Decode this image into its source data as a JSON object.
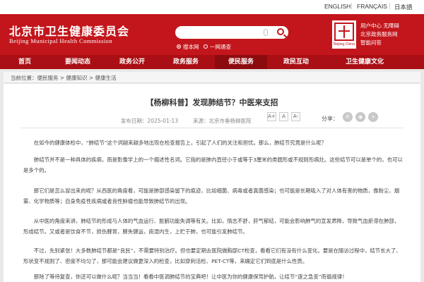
{
  "topbar": {
    "languages": [
      "ENGLISH",
      "FRANÇAIS",
      "日本語"
    ]
  },
  "header": {
    "site_name": "北京市卫生健康委员会",
    "site_name_en": "Beijing Municipal Health Commission",
    "search": {
      "placeholder": "",
      "scope_site": "搜本网",
      "scope_all": "一网通查"
    },
    "logo_text": "Beijing·China",
    "right_links": [
      "用户中心 无障碍",
      "北京政务服务网",
      "智能问答"
    ]
  },
  "nav": {
    "items": [
      "首页",
      "要闻动态",
      "政务公开",
      "政务服务",
      "便民服务",
      "政民互动",
      "卫生健康文化"
    ],
    "active_index": 4
  },
  "breadcrumb": "当前位置：便民服务 > 健康知识 > 健康生活",
  "article": {
    "title": "【杨柳科普】发现肺结节？中医来支招",
    "publish_time": "发布日期：2025-01-13",
    "source": "来源：北京市垂杨柳医院",
    "font_sizes": [
      "A+",
      "A",
      "A-"
    ],
    "share_label": "分享：",
    "share_icons": [
      "wechat-icon",
      "weibo-icon",
      "more-share-icon"
    ],
    "paragraphs": [
      "在如今的健康体检中，“肺结节”这个词越来越多地出现在检查报告上，引起了人们的关注和担忧。那么，肺结节究竟是什么呢？",
      "肺结节并不是一种具体的疾病，而是影像学上的一个描述性名词。它指的是肺内直径小于或等于3厘米的类圆形或不规则形病灶。这些结节可以是单个的，也可以是多个的。",
      "那它们是怎么冒出来的呢？从西医的角度看，可能是肺部感染留下的痕迹，比如细菌、病毒或者真菌感染；也可能是长期吸入了对人体有害的物质，像粉尘、烟雾、化学物质等；自身免疫性疾病或者良性肿瘤也能导致肺结节的出现。",
      "从中医的角度来讲，肺结节的形成与人体的气血运行、脏腑功能失调等有关。比如，情志不舒，肝气郁结，可能会影响肺气的宣发肃降，导致气血瘀滞在肺部，形成结节。又或者是饮食不节，损伤脾胃，脾失健运，痰湿内生，上贮于肺，也可能引发肺结节。",
      "不过，先别紧张！大多数肺结节都是“良民”，不需要特别治疗。但也要定期去医院做胸部CT检查，看看它们有没有什么变化。要是在随访过程中，结节长大了、形状变不规则了、密度不均匀了，那可能会建议做更深入的检查，比如穿刺活检、PET-CT等，来确定它们到底是什么性质。",
      "那除了等待复查，你还可以做什么呢？当当当！看看中医调肺结节的宝典吧！让中医为你的健康保驾护航，让结节“逐之急变”而循规律！"
    ]
  },
  "colors": {
    "brand_red": "#c3161c",
    "nav_red": "#a90f14",
    "nav_active": "#8c0b0f"
  }
}
